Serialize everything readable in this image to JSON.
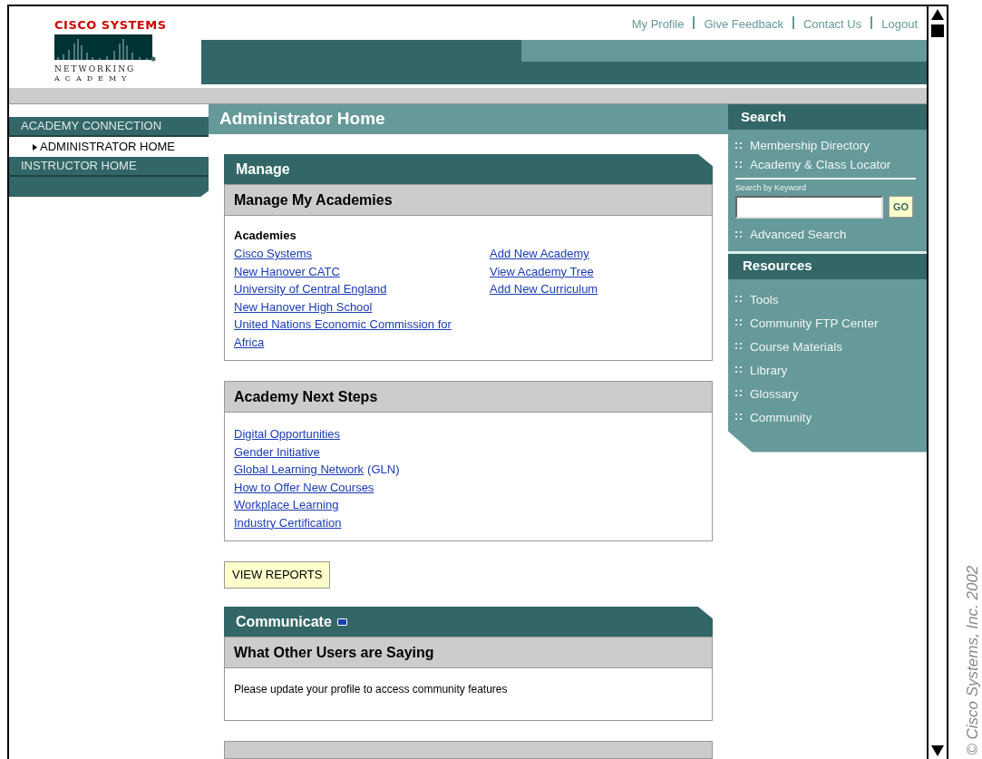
{
  "logo": {
    "brand": "CISCO SYSTEMS",
    "line1": "NETWORKING",
    "line2": "ACADEMY"
  },
  "top_links": [
    "My Profile",
    "Give Feedback",
    "Contact Us",
    "Logout"
  ],
  "nav": [
    {
      "label": "ACADEMY CONNECTION",
      "selected": false,
      "kind": "section"
    },
    {
      "label": "ADMINISTRATOR HOME",
      "selected": true,
      "kind": "sub"
    },
    {
      "label": "INSTRUCTOR HOME",
      "selected": false,
      "kind": "section"
    }
  ],
  "page_title": "Administrator Home",
  "manage": {
    "title": "Manage",
    "panels": [
      {
        "kind": "academies",
        "title": "Manage My Academies",
        "subheading": "Academies",
        "links": [
          "Cisco Systems",
          "New Hanover CATC",
          "University of Central England",
          "New Hanover High School",
          "United Nations Economic Commission for Africa"
        ],
        "actions": [
          "Add New Academy",
          "View Academy Tree",
          "Add New Curriculum"
        ]
      },
      {
        "kind": "steps",
        "title": "Academy Next Steps",
        "links": [
          {
            "label": "Digital Opportunities"
          },
          {
            "label": "Gender Initiative"
          },
          {
            "label": "Global Learning Network",
            "suffix": "(GLN)"
          },
          {
            "label": "How to Offer New Courses"
          },
          {
            "label": "Workplace Learning"
          },
          {
            "label": "Industry Certification"
          }
        ]
      }
    ]
  },
  "report_button": "VIEW REPORTS",
  "communicate": {
    "title": "Communicate",
    "panel": {
      "title": "What Other Users are Saying",
      "text": "Please update your profile to access community features"
    }
  },
  "sidebar": {
    "search": {
      "title": "Search",
      "links": [
        "Membership Directory",
        "Academy & Class Locator"
      ],
      "keyword_label": "Search by Keyword",
      "go": "GO",
      "advanced": "Advanced Search"
    },
    "resources": {
      "title": "Resources",
      "links": [
        "Tools",
        "Community FTP Center",
        "Course Materials",
        "Library",
        "Glossary",
        "Community"
      ]
    }
  },
  "copyright": "© Cisco Systems, Inc. 2002"
}
